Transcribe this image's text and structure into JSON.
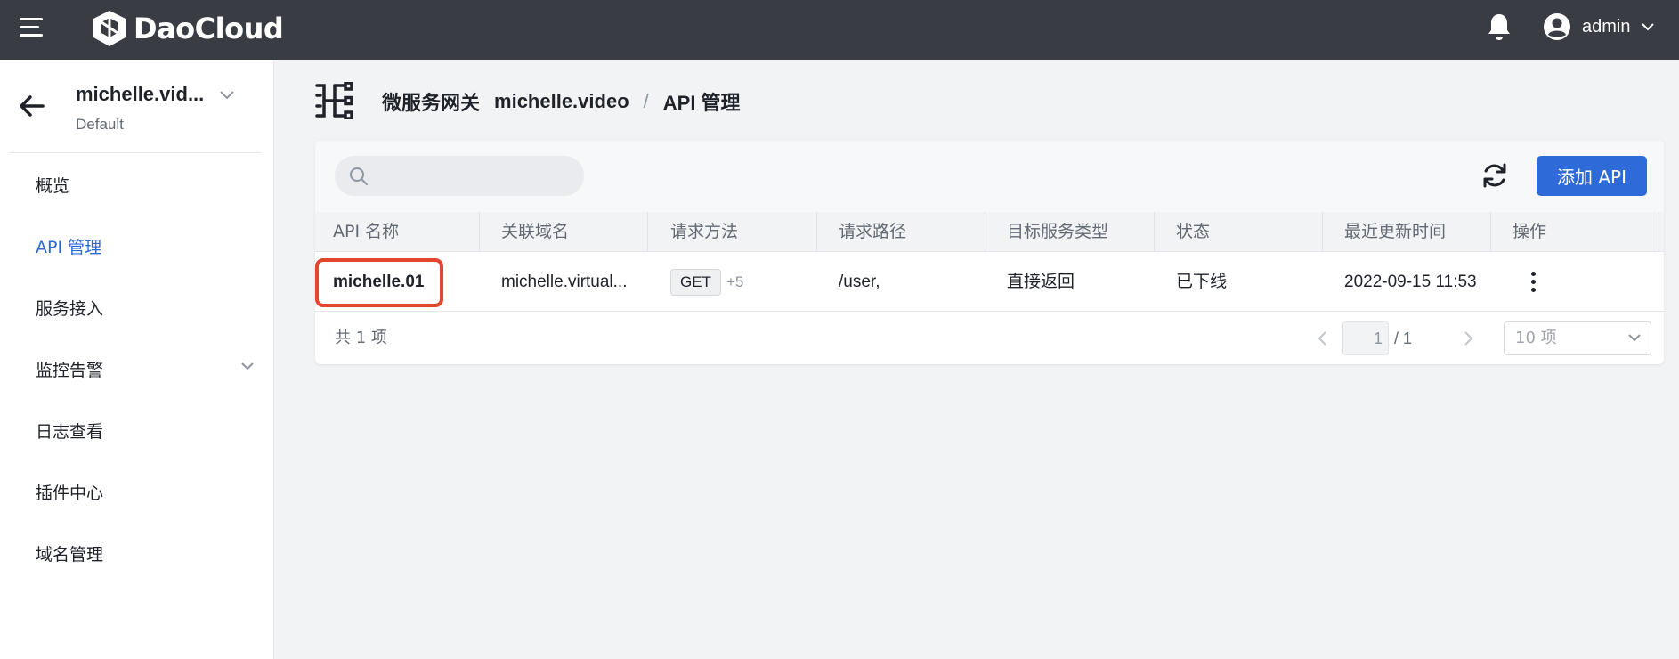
{
  "topbar": {
    "brand": "DaoCloud",
    "user": "admin",
    "colors": {
      "bg": "#393c43"
    }
  },
  "sidebar": {
    "workspace_name": "michelle.vid...",
    "workspace_sub": "Default",
    "items": [
      {
        "label": "概览",
        "active": false
      },
      {
        "label": "API 管理",
        "active": true
      },
      {
        "label": "服务接入",
        "active": false,
        "expandable": true
      },
      {
        "label": "监控告警",
        "active": false
      },
      {
        "label": "日志查看",
        "active": false
      },
      {
        "label": "插件中心",
        "active": false
      },
      {
        "label": "域名管理",
        "active": false
      }
    ]
  },
  "breadcrumb": {
    "gateway": "微服务网关",
    "instance": "michelle.video",
    "separator": "/",
    "current": "API 管理"
  },
  "toolbar": {
    "search_placeholder": "",
    "add_button": "添加 API"
  },
  "table": {
    "headers": [
      "API 名称",
      "关联域名",
      "请求方法",
      "请求路径",
      "目标服务类型",
      "状态",
      "最近更新时间",
      "操作"
    ],
    "rows": [
      {
        "name": "michelle.01",
        "domain": "michelle.virtual...",
        "method": "GET",
        "method_more": "+5",
        "path": "/user,",
        "target_type": "直接返回",
        "status": "已下线",
        "updated": "2022-09-15 11:53"
      }
    ]
  },
  "pagination": {
    "total": "共 1 项",
    "current_page": "1",
    "page_total": "/ 1",
    "page_size": "10 项"
  },
  "colors": {
    "accent": "#2f6bd8",
    "highlight": "#e4462e"
  }
}
